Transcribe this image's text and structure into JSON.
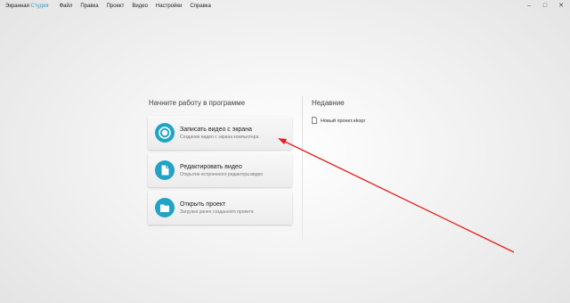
{
  "app": {
    "title_main": "Экранная ",
    "title_accent": "Студия"
  },
  "menu": [
    "Файл",
    "Правка",
    "Проект",
    "Видео",
    "Настройки",
    "Справка"
  ],
  "window_controls": {
    "minimize": "–",
    "maximize": "□",
    "close": "✕"
  },
  "start": {
    "title": "Начните работу в программе",
    "actions": [
      {
        "title": "Записать видео с экрана",
        "desc": "Создание видео с экрана компьютера",
        "icon": "record-icon"
      },
      {
        "title": "Редактировать видео",
        "desc": "Открытие встроенного редактора видео",
        "icon": "document-icon"
      },
      {
        "title": "Открыть проект",
        "desc": "Загрузка ранее созданного проекта",
        "icon": "folder-icon"
      }
    ]
  },
  "recent": {
    "title": "Недавние",
    "items": [
      {
        "name": "Новый проект.ekopr",
        "icon": "file-icon"
      }
    ]
  },
  "colors": {
    "accent": "#20a3c6",
    "annotation_arrow": "#e3201b"
  }
}
